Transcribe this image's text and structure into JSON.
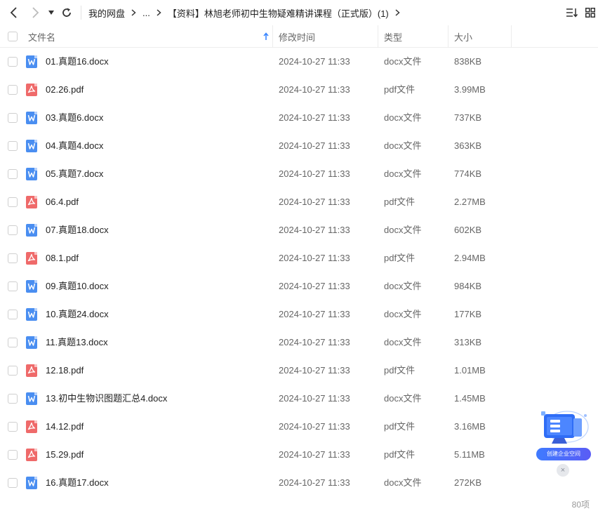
{
  "nav": {
    "back_icon": "chevron-left-icon",
    "forward_icon": "chevron-right-icon",
    "dropdown_icon": "caret-down-icon",
    "refresh_icon": "refresh-icon"
  },
  "breadcrumb": {
    "root": "我的网盘",
    "ellipsis": "...",
    "current": "【资料】林旭老师初中生物疑难精讲课程（正式版）(1)"
  },
  "toolbar": {
    "sort_icon": "sort-list-icon",
    "grid_icon": "grid-view-icon"
  },
  "table": {
    "columns": {
      "name": "文件名",
      "modified": "修改时间",
      "type": "类型",
      "size": "大小"
    },
    "rows": [
      {
        "name": "01.真题16.docx",
        "modified": "2024-10-27 11:33",
        "type": "docx文件",
        "size": "838KB",
        "kind": "doc"
      },
      {
        "name": "02.26.pdf",
        "modified": "2024-10-27 11:33",
        "type": "pdf文件",
        "size": "3.99MB",
        "kind": "pdf"
      },
      {
        "name": "03.真题6.docx",
        "modified": "2024-10-27 11:33",
        "type": "docx文件",
        "size": "737KB",
        "kind": "doc"
      },
      {
        "name": "04.真题4.docx",
        "modified": "2024-10-27 11:33",
        "type": "docx文件",
        "size": "363KB",
        "kind": "doc"
      },
      {
        "name": "05.真题7.docx",
        "modified": "2024-10-27 11:33",
        "type": "docx文件",
        "size": "774KB",
        "kind": "doc"
      },
      {
        "name": "06.4.pdf",
        "modified": "2024-10-27 11:33",
        "type": "pdf文件",
        "size": "2.27MB",
        "kind": "pdf"
      },
      {
        "name": "07.真题18.docx",
        "modified": "2024-10-27 11:33",
        "type": "docx文件",
        "size": "602KB",
        "kind": "doc"
      },
      {
        "name": "08.1.pdf",
        "modified": "2024-10-27 11:33",
        "type": "pdf文件",
        "size": "2.94MB",
        "kind": "pdf"
      },
      {
        "name": "09.真题10.docx",
        "modified": "2024-10-27 11:33",
        "type": "docx文件",
        "size": "984KB",
        "kind": "doc"
      },
      {
        "name": "10.真题24.docx",
        "modified": "2024-10-27 11:33",
        "type": "docx文件",
        "size": "177KB",
        "kind": "doc"
      },
      {
        "name": "11.真题13.docx",
        "modified": "2024-10-27 11:33",
        "type": "docx文件",
        "size": "313KB",
        "kind": "doc"
      },
      {
        "name": "12.18.pdf",
        "modified": "2024-10-27 11:33",
        "type": "pdf文件",
        "size": "1.01MB",
        "kind": "pdf"
      },
      {
        "name": "13.初中生物识图题汇总4.docx",
        "modified": "2024-10-27 11:33",
        "type": "docx文件",
        "size": "1.45MB",
        "kind": "doc"
      },
      {
        "name": "14.12.pdf",
        "modified": "2024-10-27 11:33",
        "type": "pdf文件",
        "size": "3.16MB",
        "kind": "pdf"
      },
      {
        "name": "15.29.pdf",
        "modified": "2024-10-27 11:33",
        "type": "pdf文件",
        "size": "5.11MB",
        "kind": "pdf"
      },
      {
        "name": "16.真题17.docx",
        "modified": "2024-10-27 11:33",
        "type": "docx文件",
        "size": "272KB",
        "kind": "doc"
      }
    ]
  },
  "footer": {
    "count": "80项"
  },
  "promo": {
    "label": "创建企业空间",
    "close": "×"
  },
  "colors": {
    "doc_icon": "#4a8ef1",
    "pdf_icon": "#ef6a6a",
    "sort_accent": "#3a86ff",
    "promo_gradient_start": "#3f7bff",
    "promo_gradient_end": "#5a5cf5"
  }
}
